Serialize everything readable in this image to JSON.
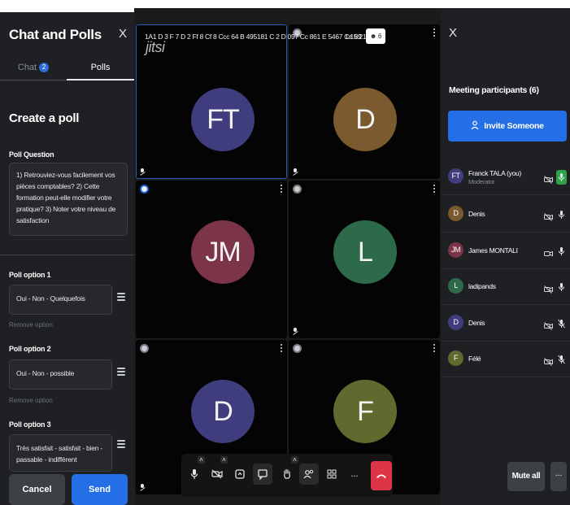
{
  "chat_panel": {
    "title": "Chat and Polls",
    "close_label": "X",
    "tabs": [
      {
        "label": "Chat",
        "badge": "2"
      },
      {
        "label": "Polls"
      }
    ],
    "create_title": "Create a poll",
    "question_label": "Poll Question",
    "question_text": "1) Retrouviez-vous facilement vos pièces comptables? 2) Cette formation peut-elle modifier votre pratique? 3) Noter votre niveau de satisfaction",
    "options": [
      {
        "label": "Poll option 1",
        "value": "Oui - Non - Quelquefois",
        "remove": "Remove option"
      },
      {
        "label": "Poll option 2",
        "value": "Oui - Non - possible",
        "remove": "Remove option"
      },
      {
        "label": "Poll option 3",
        "value": "Très satisfait - satisfait - bien - passable - indifférent"
      }
    ],
    "cancel_label": "Cancel",
    "send_label": "Send"
  },
  "stage": {
    "logo": "jitsi",
    "room_name": "1A1 D 3 F 7 D 2 Ff 8 Cf 8 Ccc 64 B 495181 C 2 D 097 Cc 861 E 5467 Ce 89",
    "timer": "1:15:21",
    "participant_count": "6",
    "tiles": [
      {
        "initials": "FT",
        "color": "#3f3d7e"
      },
      {
        "initials": "D",
        "color": "#7a5a2e"
      },
      {
        "initials": "JM",
        "color": "#7b3448"
      },
      {
        "initials": "L",
        "color": "#2c6a4a"
      },
      {
        "initials": "D",
        "color": "#3f3d7e"
      },
      {
        "initials": "F",
        "color": "#5f6a2e"
      }
    ]
  },
  "toolbar": {
    "buttons": [
      "microphone-icon",
      "camera-off-icon",
      "screen-share-icon",
      "chat-icon",
      "raise-hand-icon",
      "participants-icon",
      "tile-view-icon",
      "more-icon"
    ],
    "more_label": "...",
    "hangup": "hangup-icon",
    "hangup_color": "#dd3446"
  },
  "participants_panel": {
    "close_label": "X",
    "title": "Meeting participants (6)",
    "invite_label": "Invite Someone",
    "participants": [
      {
        "initials": "FT",
        "name": "Franck TALA (you)",
        "role": "Moderator",
        "color": "#3f3d7e"
      },
      {
        "initials": "D",
        "name": "Denis",
        "color": "#7a5a2e"
      },
      {
        "initials": "JM",
        "name": "James MONTALI",
        "color": "#7b3448"
      },
      {
        "initials": "L",
        "name": "ladipands",
        "color": "#2c6a4a"
      },
      {
        "initials": "D",
        "name": "Denis",
        "color": "#3f3d7e"
      },
      {
        "initials": "F",
        "name": "Félé",
        "color": "#5f6a2e"
      }
    ],
    "mute_all_label": "Mute all",
    "more_label": "..."
  }
}
